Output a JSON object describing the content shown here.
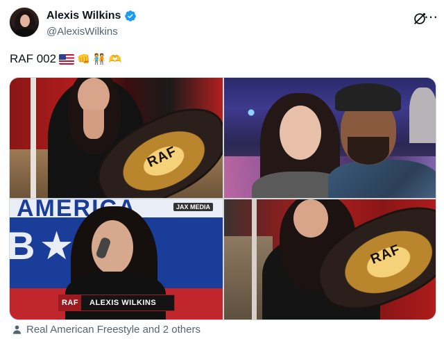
{
  "author": {
    "name": "Alexis Wilkins",
    "handle": "@AlexisWilkins",
    "verified": true,
    "verified_color": "#1d9bf0"
  },
  "post": {
    "text": "RAF 002",
    "emojis": [
      "us-flag",
      "fist",
      "people-holding-hands",
      "heart-hands"
    ]
  },
  "media": {
    "tiles": [
      {
        "name": "photo-belt-curtain",
        "belt_text": "RAF"
      },
      {
        "name": "photo-selfie-crowd"
      },
      {
        "name": "photo-singing",
        "top_text": "AMERICA",
        "big_text": "B★ER",
        "watermark": "JAX MEDIA",
        "lower_third_logo": "RAF",
        "lower_third_name": "ALEXIS WILKINS"
      },
      {
        "name": "photo-belt-laughing",
        "belt_text": "RAF"
      }
    ]
  },
  "footer": {
    "tagged_text": "Real American Freestyle and 2 others"
  },
  "icons": {
    "grok": "grok-icon",
    "more": "more-icon",
    "person": "person-icon"
  }
}
